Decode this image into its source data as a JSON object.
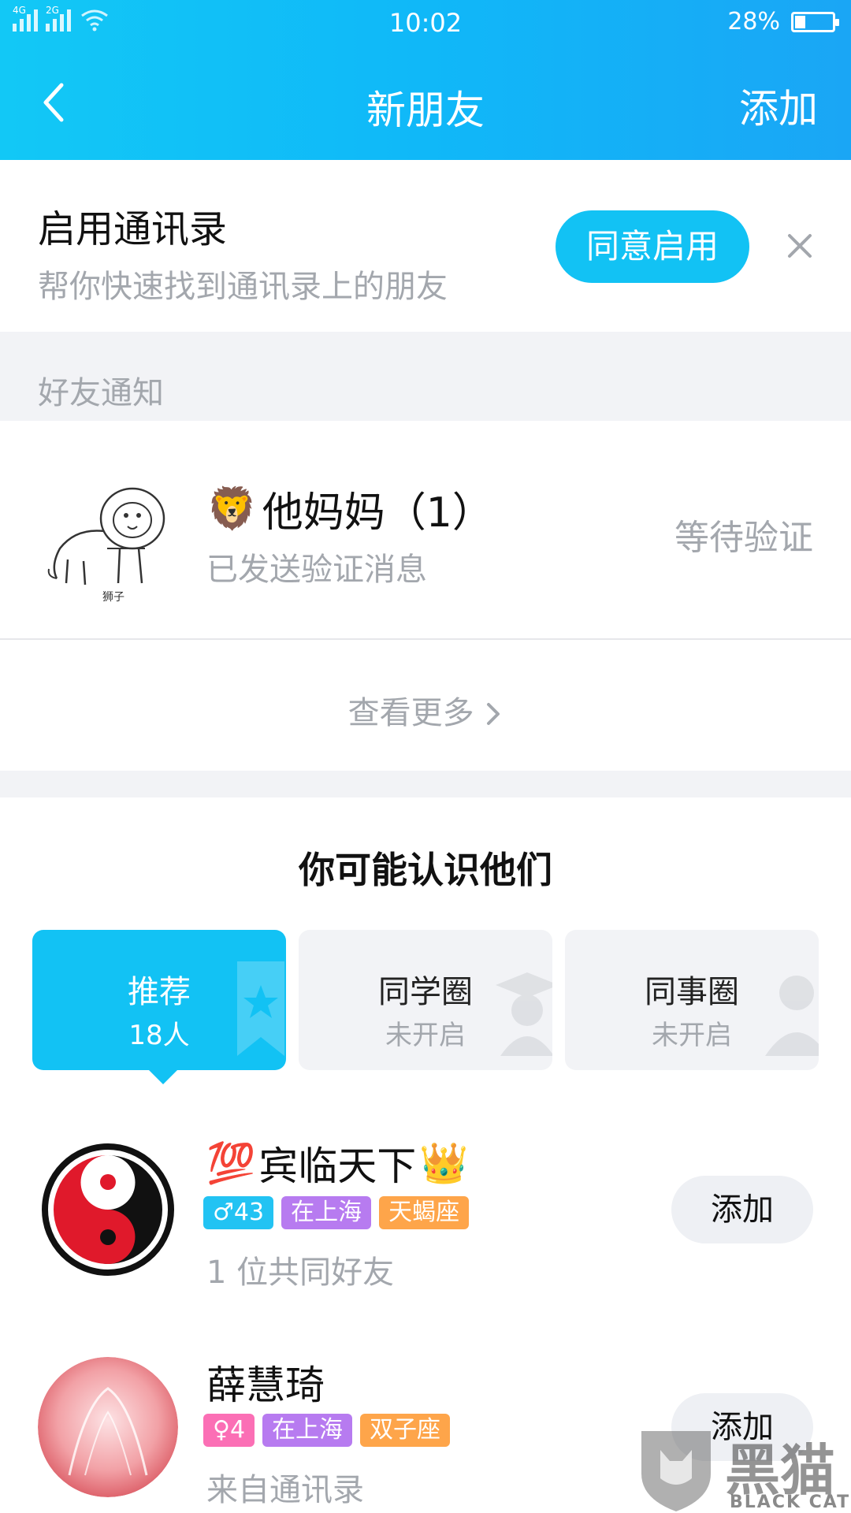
{
  "status_bar": {
    "network_1": "4G",
    "network_2": "2G",
    "time": "10:02",
    "battery": "28%",
    "battery_level": 0.28
  },
  "header": {
    "title": "新朋友",
    "add_label": "添加"
  },
  "contacts_banner": {
    "title": "启用通讯录",
    "subtitle": "帮你快速找到通讯录上的朋友",
    "agree_label": "同意启用"
  },
  "notifications": {
    "label": "好友通知",
    "item": {
      "emoji": "🦁",
      "name": "他妈妈（1）",
      "subtitle": "已发送验证消息",
      "status": "等待验证",
      "avatar_caption": "狮子"
    },
    "more_label": "查看更多"
  },
  "suggestions": {
    "title": "你可能认识他们",
    "tabs": [
      {
        "label": "推荐",
        "sub": "18人",
        "active": true
      },
      {
        "label": "同学圈",
        "sub": "未开启",
        "active": false
      },
      {
        "label": "同事圈",
        "sub": "未开启",
        "active": false
      }
    ],
    "people": [
      {
        "emoji_before": "💯",
        "name": "宾临天下",
        "emoji_after": "👑",
        "gender_age": "♂43",
        "location": "在上海",
        "zodiac": "天蝎座",
        "subtitle": "1 位共同好友",
        "add_label": "添加"
      },
      {
        "name": "薛慧琦",
        "gender_age": "♀4",
        "location": "在上海",
        "zodiac": "双子座",
        "subtitle": "来自通讯录",
        "add_label": "添加"
      }
    ]
  },
  "watermark": {
    "big": "黑猫",
    "small": "BLACK CAT"
  },
  "colors": {
    "header_gradient_start": "#12c8f6",
    "header_gradient_end": "#1aa6f5",
    "accent": "#12c2f4",
    "muted_text": "#a3a7ad",
    "tag_blue": "#22c3f3",
    "tag_pink": "#fb6fb5",
    "tag_purple": "#b77bf0",
    "tag_orange": "#fea54a"
  }
}
